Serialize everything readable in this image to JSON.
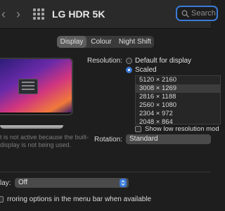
{
  "window": {
    "title": "LG HDR 5K"
  },
  "search": {
    "placeholder": "Search"
  },
  "tabs": [
    {
      "label": "Display",
      "active": true
    },
    {
      "label": "Colour",
      "active": false
    },
    {
      "label": "Night Shift",
      "active": false
    }
  ],
  "monitor_note": {
    "line1": "t is not active because the built-",
    "line2": "display is not being used."
  },
  "resolution": {
    "label": "Resolution:",
    "options": [
      {
        "label": "Default for display",
        "selected": false
      },
      {
        "label": "Scaled",
        "selected": true
      }
    ],
    "list": [
      "5120 × 2160",
      "3008 × 1269",
      "2816 × 1188",
      "2560 × 1080",
      "2304 × 972",
      "2048 × 864"
    ],
    "selected_index": 1
  },
  "low_res": {
    "label": "Show low resolution mod"
  },
  "rotation": {
    "label": "Rotation:",
    "value": "Standard"
  },
  "airplay": {
    "label": "lay:",
    "value": "Off"
  },
  "mirroring": {
    "label": "rroring options in the menu bar when available"
  },
  "colors": {
    "accent": "#3b7bd8",
    "window_bg": "#1e1e1e"
  }
}
